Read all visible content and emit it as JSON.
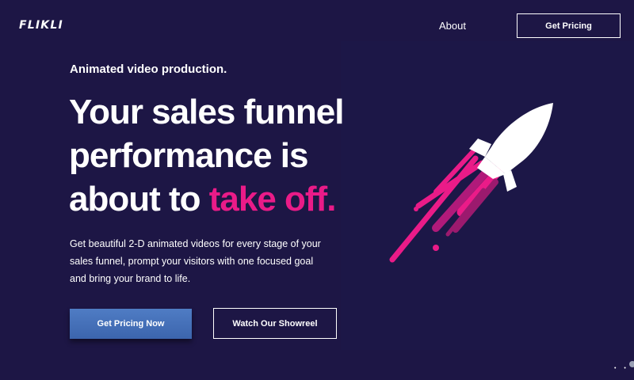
{
  "header": {
    "logo": "FLIKLI",
    "nav": {
      "about_label": "About",
      "pricing_label": "Get Pricing"
    }
  },
  "hero": {
    "eyebrow": "Animated video production.",
    "headline": {
      "line1": "Your sales funnel",
      "line2": "performance is",
      "line3_plain": "about to ",
      "line3_accent": "take off."
    },
    "description": {
      "line1": "Get beautiful 2-D animated videos for every stage of your",
      "line2": "sales funnel, prompt your visitors with one focused goal",
      "line3": "and bring your brand to life."
    },
    "primary_cta": "Get Pricing Now",
    "secondary_cta": "Watch Our Showreel"
  },
  "illustration": {
    "icon": "rocket-icon",
    "trail_color": "#ea1b88",
    "trail_dark_color": "#9b1a6e",
    "rocket_color": "#ffffff"
  },
  "colors": {
    "background": "#1d1645",
    "accent": "#ea1b88",
    "primary_button": "#4a74bd"
  }
}
